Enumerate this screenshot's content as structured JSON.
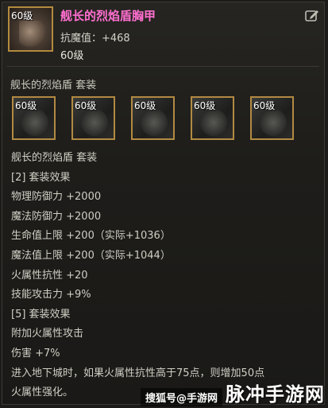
{
  "item": {
    "level_badge": "60级",
    "title": "舰长的烈焰盾胸甲",
    "stat": "抗魔值：+468",
    "level": "60级"
  },
  "set": {
    "title": "舰长的烈焰盾  套装",
    "slots": [
      {
        "level": "60级",
        "icon": "armor-piece-icon"
      },
      {
        "level": "60级",
        "icon": "armor-piece-icon"
      },
      {
        "level": "60级",
        "icon": "armor-piece-icon"
      },
      {
        "level": "60级",
        "icon": "armor-piece-icon"
      },
      {
        "level": "60级",
        "icon": "armor-piece-icon"
      }
    ],
    "lines": [
      "舰长的烈焰盾  套装",
      "[2] 套装效果",
      "物理防御力 +2000",
      "魔法防御力 +2000",
      "生命值上限 +200（实际+1036）",
      "魔法值上限 +200（实际+1044）",
      "火属性抗性 +20",
      "技能攻击力 +9%",
      "[5] 套装效果",
      "附加火属性攻击",
      "伤害 +7%",
      "进入地下城时，如果火属性抗性高于75点，则增加50点",
      "火属性强化。"
    ]
  },
  "watermark": {
    "small": "搜狐号@手游网",
    "big": "脉冲手游网"
  },
  "colors": {
    "title": "#ff6fd0",
    "slot_border": "#b28a42"
  }
}
